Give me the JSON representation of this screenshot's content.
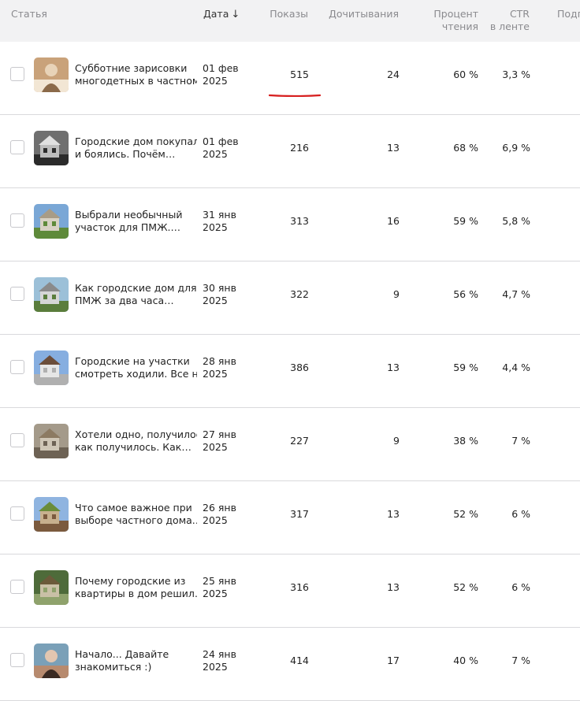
{
  "header": {
    "article": "Статья",
    "date": "Дата",
    "date_arrow": "↓",
    "views": "Показы",
    "read_through": "Дочитывания",
    "percent_line1": "Процент",
    "percent_line2": "чтения",
    "ctr_line1": "CTR",
    "ctr_line2": "в ленте",
    "subscriptions": "Подп"
  },
  "rows": [
    {
      "title1": "Субботние зарисовки",
      "title2": "многодетных в частном…",
      "date1": "01 фев",
      "date2": "2025",
      "views": "515",
      "read": "24",
      "percent": "60 %",
      "ctr": "3,3 %",
      "thumb": "portrait-icon"
    },
    {
      "title1": "Городские дом покупали",
      "title2": "и боялись. Почём…",
      "date1": "01 фев",
      "date2": "2025",
      "views": "216",
      "read": "13",
      "percent": "68 %",
      "ctr": "6,9 %",
      "thumb": "house-icon"
    },
    {
      "title1": "Выбрали необычный",
      "title2": "участок для ПМЖ.…",
      "date1": "31 янв",
      "date2": "2025",
      "views": "313",
      "read": "16",
      "percent": "59 %",
      "ctr": "5,8 %",
      "thumb": "house-icon"
    },
    {
      "title1": "Как городские дом для",
      "title2": "ПМЖ за два часа…",
      "date1": "30 янв",
      "date2": "2025",
      "views": "322",
      "read": "9",
      "percent": "56 %",
      "ctr": "4,7 %",
      "thumb": "house-icon"
    },
    {
      "title1": "Городские на участки",
      "title2": "смотреть ходили. Все н…",
      "date1": "28 янв",
      "date2": "2025",
      "views": "386",
      "read": "13",
      "percent": "59 %",
      "ctr": "4,4 %",
      "thumb": "house-icon"
    },
    {
      "title1": "Хотели одно, получилось",
      "title2": "как получилось. Как…",
      "date1": "27 янв",
      "date2": "2025",
      "views": "227",
      "read": "9",
      "percent": "38 %",
      "ctr": "7 %",
      "thumb": "house-icon"
    },
    {
      "title1": "Что самое важное при",
      "title2": "выборе частного дома.…",
      "date1": "26 янв",
      "date2": "2025",
      "views": "317",
      "read": "13",
      "percent": "52 %",
      "ctr": "6 %",
      "thumb": "house-icon"
    },
    {
      "title1": "Почему городские из",
      "title2": "квартиры в дом решил…",
      "date1": "25 янв",
      "date2": "2025",
      "views": "316",
      "read": "13",
      "percent": "52 %",
      "ctr": "6 %",
      "thumb": "house-icon"
    },
    {
      "title1": "Начало... Давайте",
      "title2": "знакомиться :)",
      "date1": "24 янв",
      "date2": "2025",
      "views": "414",
      "read": "17",
      "percent": "40 %",
      "ctr": "7 %",
      "thumb": "portrait-icon"
    }
  ],
  "colors": {
    "header_bg": "#f2f2f3",
    "row_divider": "#d9d9dc",
    "highlight_underline": "#d71f1f"
  }
}
